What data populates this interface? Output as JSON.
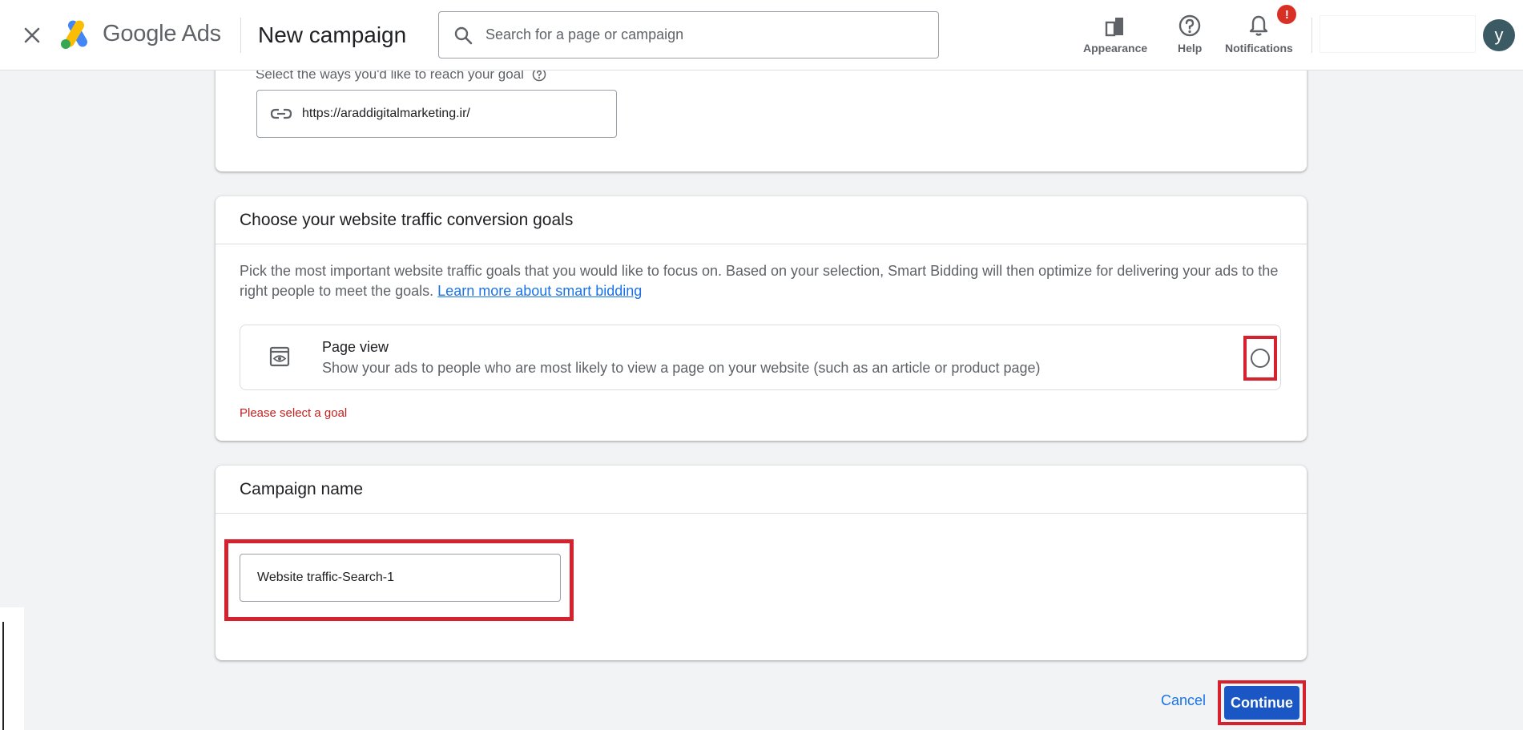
{
  "header": {
    "brand_google": "Google",
    "brand_ads": "Ads",
    "page_title": "New campaign",
    "search_placeholder": "Search for a page or campaign",
    "tools": [
      {
        "label": "Appearance",
        "icon": "appearance-icon"
      },
      {
        "label": "Help",
        "icon": "help-icon"
      },
      {
        "label": "Notifications",
        "icon": "bell-icon",
        "badge": "!"
      }
    ],
    "avatar_letter": "y"
  },
  "reach": {
    "label": "Select the ways you'd like to reach your goal",
    "url_value": "https://araddigitalmarketing.ir/"
  },
  "conversion_goals": {
    "title": "Choose your website traffic conversion goals",
    "description": "Pick the most important website traffic goals that you would like to focus on. Based on your selection, Smart Bidding will then optimize for delivering your ads to the right people to meet the goals.",
    "learn_more_link": "Learn more about smart bidding",
    "option": {
      "title": "Page view",
      "description": "Show your ads to people who are most likely to view a page on your website (such as an article or product page)",
      "selected": false
    },
    "error": "Please select a goal"
  },
  "campaign_name": {
    "title": "Campaign name",
    "value": "Website traffic-Search-1"
  },
  "footer": {
    "cancel_label": "Cancel",
    "continue_label": "Continue"
  },
  "colors": {
    "accent": "#1a73e8",
    "primary_button": "#1a57c4",
    "error": "#c5221f",
    "highlight": "#d6212f"
  }
}
